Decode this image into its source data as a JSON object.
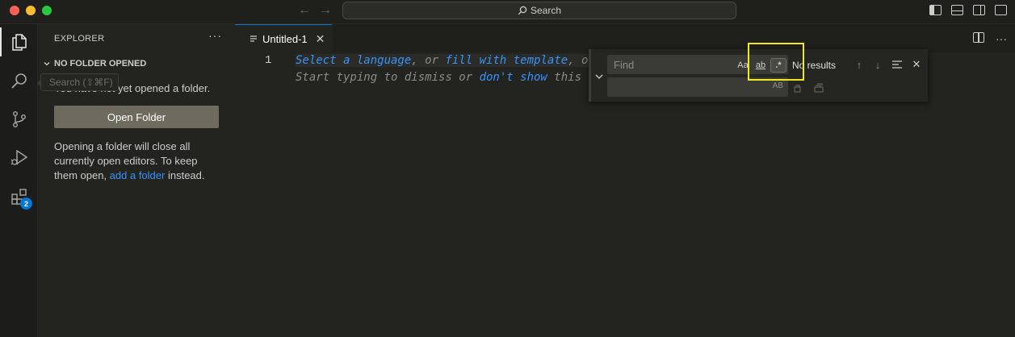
{
  "titlebar": {
    "search_label": "Search"
  },
  "activity_bar": {
    "items": [
      {
        "name": "explorer",
        "icon": "files-icon",
        "active": true
      },
      {
        "name": "search",
        "icon": "search-icon"
      },
      {
        "name": "source-control",
        "icon": "source-control-icon"
      },
      {
        "name": "run-debug",
        "icon": "run-debug-icon"
      },
      {
        "name": "extensions",
        "icon": "extensions-icon",
        "badge": "2"
      }
    ],
    "tooltip": "Search (⇧⌘F)"
  },
  "sidebar": {
    "title": "EXPLORER",
    "more": "···",
    "section_title": "NO FOLDER OPENED",
    "message": "You have not yet opened a folder.",
    "open_folder_button": "Open Folder",
    "info_part1": "Opening a folder will close all currently open editors. To keep them open,",
    "info_link": "add a folder",
    "info_part2": "instead."
  },
  "editor": {
    "tab_title": "Untitled-1",
    "line_number": "1",
    "line1": {
      "select": "Select a language",
      "sep1": ", or ",
      "fill": "fill with template",
      "sep2": ", o"
    },
    "line2": {
      "start": "Start typing to dismiss or ",
      "dont_show": "don't show",
      "end": " this"
    }
  },
  "find_widget": {
    "find_placeholder": "Find",
    "match_case_label": "Aa",
    "whole_word_label": "ab",
    "regex_label": ".*",
    "preserve_case_label": "AB",
    "result": "No results",
    "regex_enabled": true
  },
  "colors": {
    "accent": "#0078d4",
    "link": "#3794ff",
    "highlight_box": "#f2e820"
  }
}
